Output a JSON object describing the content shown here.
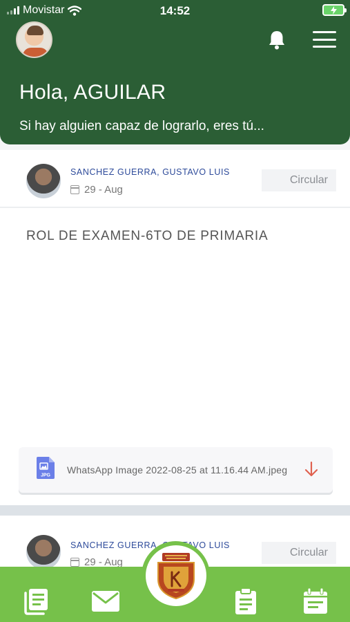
{
  "status_bar": {
    "carrier": "Movistar",
    "time": "14:52"
  },
  "header": {
    "greeting": "Hola, AGUILAR",
    "motto": "Si hay alguien capaz de lograrlo, eres tú..."
  },
  "posts": [
    {
      "author": "SANCHEZ GUERRA, GUSTAVO  LUIS",
      "date": "29 - Aug",
      "tag": "Circular",
      "title": "ROL DE EXAMEN-6TO DE PRIMARIA",
      "attachment": {
        "type_label": "JPG",
        "file_name": "WhatsApp Image 2022-08-25 at 11.16.44 AM.jpeg"
      }
    },
    {
      "author": "SANCHEZ GUERRA, GUSTAVO  LUIS",
      "date": "29 - Aug",
      "tag": "Circular"
    }
  ],
  "bottom_nav": {
    "items": [
      "news-icon",
      "mail-icon",
      "school-crest",
      "clipboard-icon",
      "calendar-icon"
    ]
  },
  "colors": {
    "header_bg": "#2b5e35",
    "nav_bg": "#76c14a",
    "author_name": "#2d4a9a",
    "download_arrow": "#e0614f"
  }
}
